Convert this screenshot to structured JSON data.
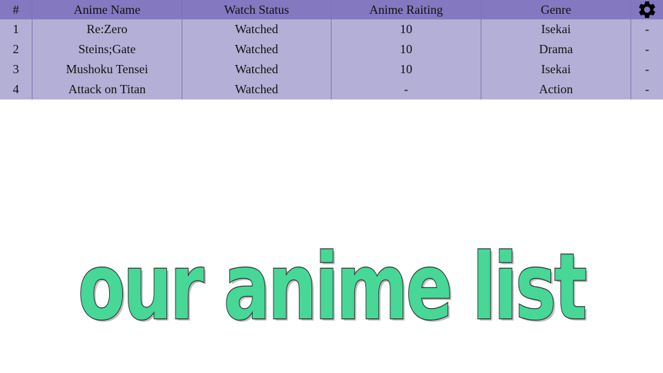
{
  "table": {
    "headers": [
      "#",
      "Anime Name",
      "Watch Status",
      "Anime Raiting",
      "Genre"
    ],
    "settings_icon": "gear-icon",
    "rows": [
      {
        "num": "1",
        "name": "Re:Zero",
        "status": "Watched",
        "rating": "10",
        "genre": "Isekai",
        "action": "-"
      },
      {
        "num": "2",
        "name": "Steins;Gate",
        "status": "Watched",
        "rating": "10",
        "genre": "Drama",
        "action": "-"
      },
      {
        "num": "3",
        "name": "Mushoku Tensei",
        "status": "Watched",
        "rating": "10",
        "genre": "Isekai",
        "action": "-"
      },
      {
        "num": "4",
        "name": "Attack on Titan",
        "status": "Watched",
        "rating": "-",
        "genre": "Action",
        "action": "-"
      }
    ]
  },
  "title": {
    "text": "our anime list",
    "fill_color": "#47d797",
    "stroke_color": "#2d2d2d"
  },
  "colors": {
    "header_bg": "#8478c0",
    "row_bg": "#b4afd6"
  }
}
